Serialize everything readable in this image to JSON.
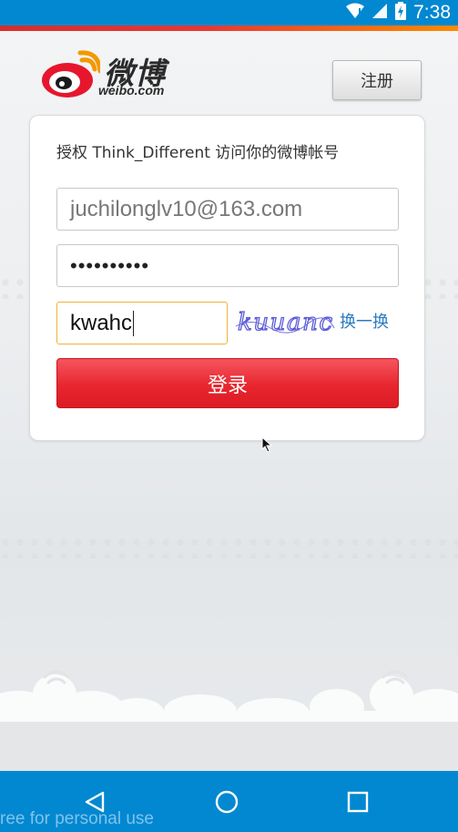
{
  "status_bar": {
    "time": "7:38",
    "icons": [
      "wifi-icon",
      "signal-icon",
      "battery-charging-icon"
    ]
  },
  "header": {
    "logo_cn": "微博",
    "logo_en": "weibo.com",
    "register_label": "注册"
  },
  "auth": {
    "prompt": "授权 Think_Different 访问你的微博帐号",
    "account_value": "juchilonglv10@163.com",
    "password_masked": "••••••••••",
    "captcha_value": "kwahc",
    "captcha_image_text": "kuuanc",
    "refresh_label": "换一换",
    "login_label": "登录"
  },
  "nav": {
    "buttons": [
      "back-icon",
      "home-icon",
      "recents-icon"
    ]
  },
  "watermark": "ree for personal use",
  "colors": {
    "status_bar": "#0288d1",
    "login_button": "#e8262f",
    "link": "#2b7bc0",
    "captcha_focus_border": "#f0b13a"
  }
}
